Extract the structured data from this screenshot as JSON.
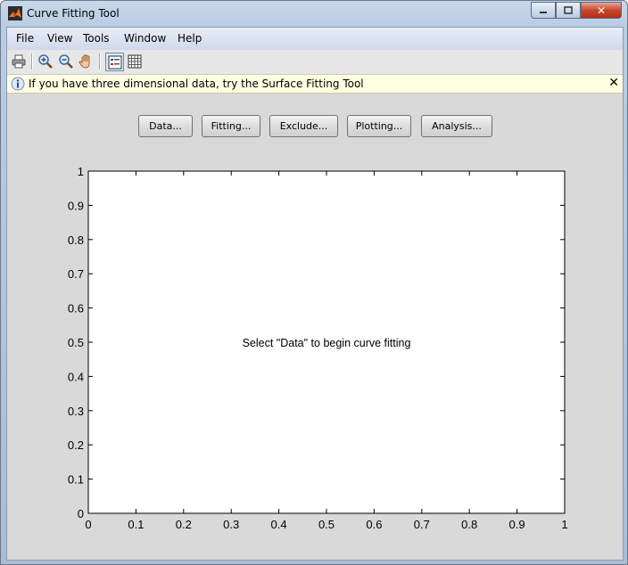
{
  "window": {
    "title": "Curve Fitting Tool"
  },
  "menu": [
    "File",
    "View",
    "Tools",
    "Window",
    "Help"
  ],
  "toolbar": {
    "icons": [
      "print-icon",
      "zoom-in-icon",
      "zoom-out-icon",
      "pan-hand-icon",
      "legend-toggle-icon",
      "grid-toggle-icon"
    ]
  },
  "infobar": {
    "text": "If you have three dimensional data, try the Surface Fitting Tool",
    "close": "✕"
  },
  "buttons": {
    "data": "Data...",
    "fitting": "Fitting...",
    "exclude": "Exclude...",
    "plotting": "Plotting...",
    "analysis": "Analysis..."
  },
  "plot": {
    "message": "Select \"Data\" to begin curve fitting"
  },
  "chart_data": {
    "type": "scatter",
    "series": [],
    "xlim": [
      0,
      1
    ],
    "ylim": [
      0,
      1
    ],
    "xticks": [
      "0",
      "0.1",
      "0.2",
      "0.3",
      "0.4",
      "0.5",
      "0.6",
      "0.7",
      "0.8",
      "0.9",
      "1"
    ],
    "yticks": [
      "0",
      "0.1",
      "0.2",
      "0.3",
      "0.4",
      "0.5",
      "0.6",
      "0.7",
      "0.8",
      "0.9",
      "1"
    ],
    "grid": false,
    "title": "",
    "xlabel": "",
    "ylabel": ""
  },
  "colors": {
    "client_bg": "#d9d9d9",
    "info_bg": "#ffffe1",
    "plot_bg": "#ffffff"
  }
}
